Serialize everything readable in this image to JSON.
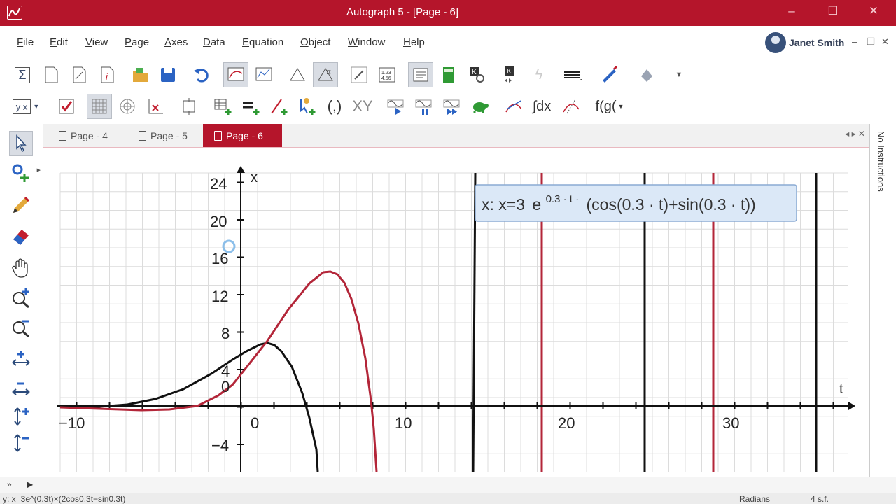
{
  "window": {
    "title": "Autograph 5 - [Page - 6]",
    "controls": [
      "–",
      "☐",
      "✕"
    ]
  },
  "menu": [
    "File",
    "Edit",
    "View",
    "Page",
    "Axes",
    "Data",
    "Equation",
    "Object",
    "Window",
    "Help"
  ],
  "user": {
    "name": "Janet Smith"
  },
  "mdi_controls": [
    "–",
    "❐",
    "✕"
  ],
  "toolbar2": {
    "yx_label": "y x",
    "parens_label": "(,)",
    "xy_label": "XY",
    "fg_label": "f(g("
  },
  "tabs": [
    {
      "label": "Page - 4",
      "active": false
    },
    {
      "label": "Page - 5",
      "active": false
    },
    {
      "label": "Page - 6",
      "active": true
    }
  ],
  "right_panel": {
    "label": "No Instructions"
  },
  "graph": {
    "equation_prefix": "x: x=3",
    "equation_exp": "e",
    "equation_sup": "0.3 · t ·",
    "equation_rest": "(cos(0.3 · t)+sin(0.3 · t))",
    "x_axis_label": "t",
    "y_axis_label": "x",
    "x_ticks": [
      "−10",
      "0",
      "10",
      "20",
      "30"
    ],
    "y_ticks": [
      "24",
      "20",
      "16",
      "12",
      "8",
      "4",
      "0",
      "−4"
    ],
    "colors": {
      "black_curve": "#111111",
      "red_curve": "#b32639",
      "grid": "#dcdcdc"
    }
  },
  "status": {
    "formula": "y: x=3e^(0.3t)×(2cos0.3t−sin0.3t)",
    "angle_mode": "Radians",
    "precision": "4 s.f."
  }
}
